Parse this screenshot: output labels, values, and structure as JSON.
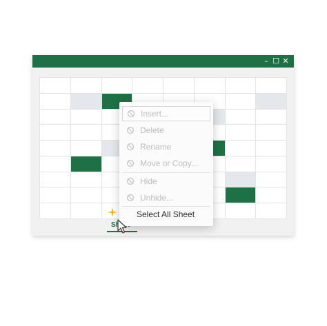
{
  "window": {
    "controls": {
      "minimize": "–",
      "maximize": "☐",
      "close": "✕"
    },
    "accent_color": "#1e7145"
  },
  "sheet_tab": {
    "label": "Sheet"
  },
  "context_menu": {
    "items": [
      {
        "label": "Insert...",
        "icon": "disabled-icon",
        "enabled": false
      },
      {
        "label": "Delete",
        "icon": "disabled-icon",
        "enabled": false
      },
      {
        "label": "Rename",
        "icon": "disabled-icon",
        "enabled": false
      },
      {
        "label": "Move or Copy...",
        "icon": "disabled-icon",
        "enabled": false
      },
      {
        "label": "Hide",
        "icon": "disabled-icon",
        "enabled": false
      },
      {
        "label": "Unhide...",
        "icon": "disabled-icon",
        "enabled": false
      },
      {
        "label": "Select All Sheet",
        "enabled": true
      }
    ]
  },
  "grid": {
    "rows": 9,
    "cols": 8,
    "highlighted": [
      {
        "row": 1,
        "col": 2,
        "state": "green"
      },
      {
        "row": 1,
        "col": 1,
        "state": "gray"
      },
      {
        "row": 1,
        "col": 7,
        "state": "gray"
      },
      {
        "row": 2,
        "col": 5,
        "state": "gray"
      },
      {
        "row": 4,
        "col": 2,
        "state": "gray"
      },
      {
        "row": 4,
        "col": 5,
        "state": "green"
      },
      {
        "row": 5,
        "col": 1,
        "state": "green"
      },
      {
        "row": 6,
        "col": 6,
        "state": "gray"
      },
      {
        "row": 7,
        "col": 6,
        "state": "green"
      }
    ]
  }
}
